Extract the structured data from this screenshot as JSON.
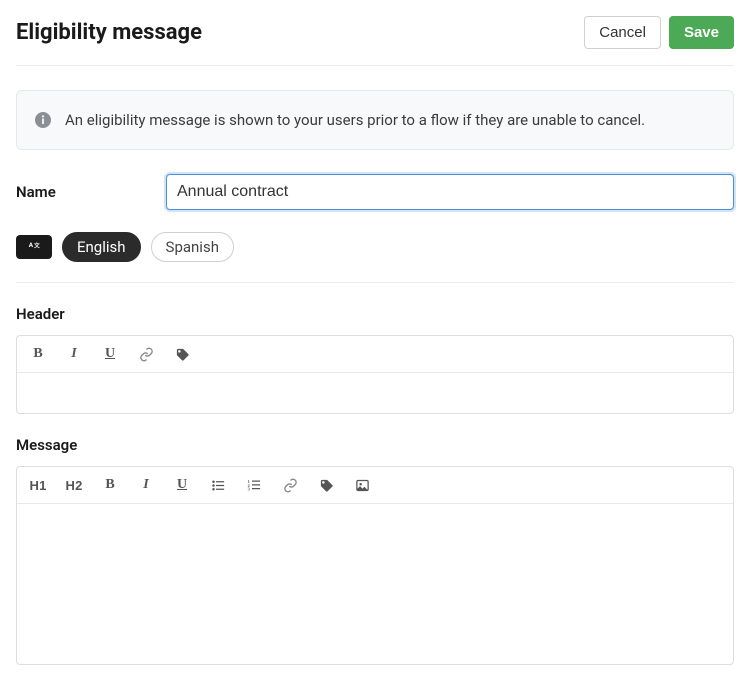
{
  "header": {
    "title": "Eligibility message",
    "cancel_label": "Cancel",
    "save_label": "Save"
  },
  "info": {
    "text": "An eligibility message is shown to your users prior to a flow if they are unable to cancel."
  },
  "form": {
    "name_label": "Name",
    "name_value": "Annual contract"
  },
  "languages": {
    "items": [
      {
        "label": "English",
        "active": true
      },
      {
        "label": "Spanish",
        "active": false
      }
    ]
  },
  "sections": {
    "header_label": "Header",
    "message_label": "Message"
  },
  "toolbar": {
    "h1": "H1",
    "h2": "H2"
  }
}
